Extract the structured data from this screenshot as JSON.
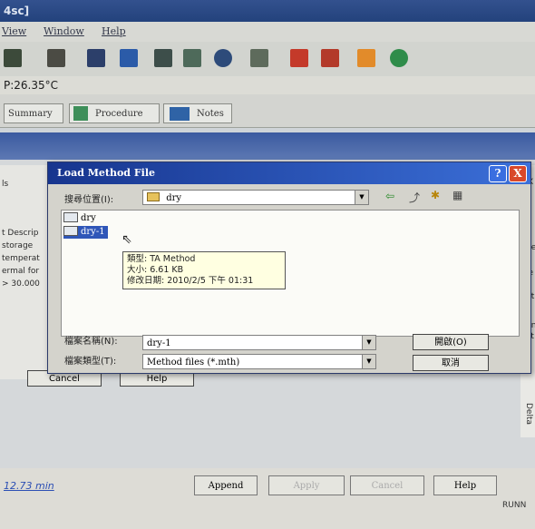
{
  "window": {
    "title_fragment": "4sc]"
  },
  "menu": {
    "items": [
      "View",
      "Window",
      "Help"
    ]
  },
  "header": {
    "temperature": "P:26.35°C"
  },
  "tabs": [
    {
      "label": "Summary"
    },
    {
      "label": "Procedure"
    },
    {
      "label": "Notes"
    }
  ],
  "background": {
    "fragments": [
      "ls",
      "t Descrip",
      "storage",
      "temperat",
      "ermal for",
      "> 30.000"
    ],
    "right_fragments": [
      "X",
      "ne",
      "ie",
      "nt",
      "un",
      "xt",
      "r in"
    ],
    "cancel_label": "Cancel",
    "help_label": "Help",
    "delta_label": "Delta"
  },
  "dialog": {
    "title": "Load Method File",
    "help_btn": "?",
    "close_btn": "X",
    "look_in_label": "搜尋位置(I):",
    "look_in_value": "dry",
    "files": [
      {
        "name": "dry",
        "selected": false
      },
      {
        "name": "dry-1",
        "selected": true
      }
    ],
    "tooltip": {
      "type": "類型: TA Method",
      "size": "大小: 6.61 KB",
      "modified": "修改日期: 2010/2/5 下午 01:31"
    },
    "file_name_label": "檔案名稱(N):",
    "file_name_value": "dry-1",
    "file_type_label": "檔案類型(T):",
    "file_type_value": "Method files (*.mth)",
    "open_btn": "開啟(O)",
    "cancel_btn": "取消"
  },
  "bottom": {
    "time": "12.73 min",
    "append": "Append",
    "apply": "Apply",
    "cancel": "Cancel",
    "help": "Help",
    "status": "RUNN"
  },
  "colors": {
    "titlebar": "#23427c",
    "dialog_title": "#17358e",
    "tooltip": "#ffffe1",
    "selected": "#2f56b8"
  }
}
